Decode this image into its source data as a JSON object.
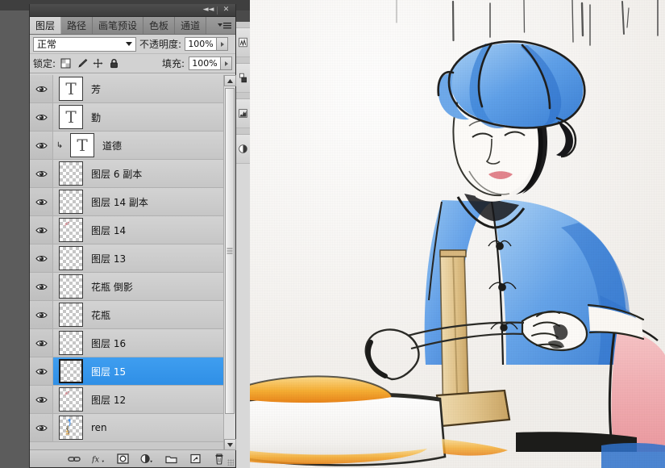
{
  "app": {
    "title": "Adobe Photoshop - Layers Panel"
  },
  "titlebar": {
    "collapse_label": "◄◄",
    "close_label": "✕",
    "collapse_icon": "collapse-dock-icon",
    "close_icon": "close-icon"
  },
  "tabs": [
    {
      "label": "图层",
      "active": true
    },
    {
      "label": "路径",
      "active": false
    },
    {
      "label": "画笔预设",
      "active": false
    },
    {
      "label": "色板",
      "active": false
    },
    {
      "label": "通道",
      "active": false
    }
  ],
  "panel_menu": {
    "icon": "panel-menu-icon"
  },
  "blend_row": {
    "mode_value": "正常",
    "opacity_label": "不透明度:",
    "opacity_value": "100%"
  },
  "lock_row": {
    "lock_label": "锁定:",
    "fill_label": "填充:",
    "fill_value": "100%",
    "icons": [
      "lock-transparent-pixels-icon",
      "lock-image-pixels-icon",
      "lock-position-icon",
      "lock-all-icon"
    ]
  },
  "layers": [
    {
      "name": "芳",
      "type": "text",
      "visible": true,
      "selected": false,
      "clipped": false
    },
    {
      "name": "勤",
      "type": "text",
      "visible": true,
      "selected": false,
      "clipped": false
    },
    {
      "name": "道德",
      "type": "text",
      "visible": true,
      "selected": false,
      "clipped": true
    },
    {
      "name": "图层 6 副本",
      "type": "pixel",
      "visible": true,
      "selected": false,
      "clipped": false
    },
    {
      "name": "图层 14 副本",
      "type": "pixel",
      "visible": true,
      "selected": false,
      "clipped": false
    },
    {
      "name": "图层 14",
      "type": "pixel",
      "visible": true,
      "selected": false,
      "clipped": false,
      "art": "speck"
    },
    {
      "name": "图层 13",
      "type": "pixel",
      "visible": true,
      "selected": false,
      "clipped": false
    },
    {
      "name": "花瓶 倒影",
      "type": "pixel",
      "visible": true,
      "selected": false,
      "clipped": false
    },
    {
      "name": "花瓶",
      "type": "pixel",
      "visible": true,
      "selected": false,
      "clipped": false
    },
    {
      "name": "图层 16",
      "type": "pixel",
      "visible": true,
      "selected": false,
      "clipped": false
    },
    {
      "name": "图层 15",
      "type": "pixel",
      "visible": true,
      "selected": true,
      "clipped": false
    },
    {
      "name": "图层 12",
      "type": "pixel",
      "visible": true,
      "selected": false,
      "clipped": false,
      "art": "speck"
    },
    {
      "name": "ren",
      "type": "pixel",
      "visible": true,
      "selected": false,
      "clipped": false,
      "art": "figure"
    }
  ],
  "scrollbar": {
    "up_icon": "scroll-up-arrow-icon",
    "down_icon": "scroll-down-arrow-icon"
  },
  "bottom_toolbar": [
    {
      "icon": "link-layers-icon",
      "title": "链接图层"
    },
    {
      "icon": "layer-style-fx-icon",
      "title": "fx"
    },
    {
      "icon": "layer-mask-icon",
      "title": "添加图层蒙版"
    },
    {
      "icon": "adjustment-layer-icon",
      "title": "创建调整图层"
    },
    {
      "icon": "new-group-icon",
      "title": "创建新组"
    },
    {
      "icon": "new-layer-icon",
      "title": "创建新图层"
    },
    {
      "icon": "delete-layer-icon",
      "title": "删除图层"
    }
  ],
  "icon_dock": [
    {
      "icon": "mini-bridge-icon"
    },
    {
      "icon": "color-swatch-icon"
    },
    {
      "icon": "histogram-icon"
    },
    {
      "icon": "adjustments-icon"
    }
  ],
  "colors": {
    "selection_blue": "#2f8fe6",
    "panel_bg": "#d4d4d4",
    "list_bg": "#c9c9c9",
    "workspace": "#5c5c5c",
    "canvas_paper": "#f1eeea",
    "art_blue": "#4a8fe0",
    "art_pink": "#f0a9ad",
    "art_orange": "#f0a028",
    "art_tan": "#e3c38a",
    "art_ink": "#20201e"
  },
  "artwork": {
    "alt": "Watercolor illustration of a woman in blue headwrap and jacket cooking over a pot"
  }
}
